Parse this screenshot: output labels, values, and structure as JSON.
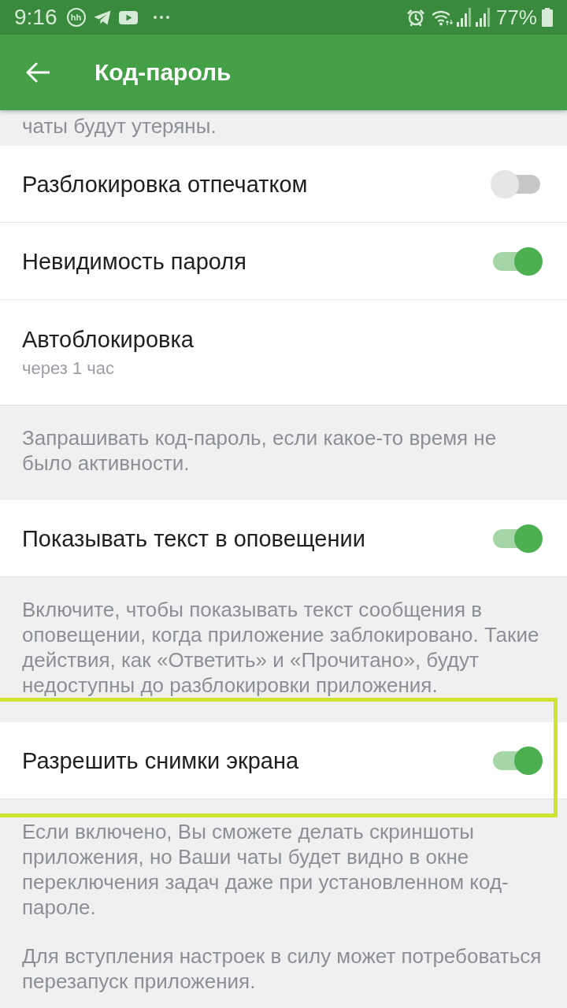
{
  "status_bar": {
    "time": "9:16",
    "notifications": [
      {
        "kind": "badge",
        "text": "hh"
      },
      {
        "kind": "plane"
      },
      {
        "kind": "play"
      },
      {
        "kind": "more"
      }
    ],
    "battery": "77%"
  },
  "app_bar": {
    "title": "Код-пароль"
  },
  "top_note": "чаты будут утеряны.",
  "sections": [
    {
      "rows": [
        {
          "kind": "switch",
          "label": "Разблокировка отпечатком",
          "on": false,
          "highlighted": false
        },
        {
          "kind": "switch",
          "label": "Невидимость пароля",
          "on": true,
          "highlighted": false
        },
        {
          "kind": "value",
          "label": "Автоблокировка",
          "value": "через 1 час",
          "highlighted": false
        }
      ],
      "footer": [
        "Запрашивать код-пароль, если какое-то время не было активности."
      ]
    },
    {
      "rows": [
        {
          "kind": "switch",
          "label": "Показывать текст в оповещении",
          "on": true,
          "highlighted": false
        }
      ],
      "footer": [
        "Включите, чтобы показывать текст сообщения в оповещении, когда приложение заблокировано. Такие действия, как «Ответить» и «Прочитано», будут недоступны до разблокировки приложения."
      ]
    },
    {
      "rows": [
        {
          "kind": "switch",
          "label": "Разрешить снимки экрана",
          "on": true,
          "highlighted": true
        }
      ],
      "footer": [
        "Если включено, Вы сможете делать скриншоты приложения, но Ваши чаты будет видно в окне переключения задач даже при установленном код-пароле.",
        "Для вступления настроек в силу может потребоваться перезапуск приложения."
      ]
    }
  ]
}
